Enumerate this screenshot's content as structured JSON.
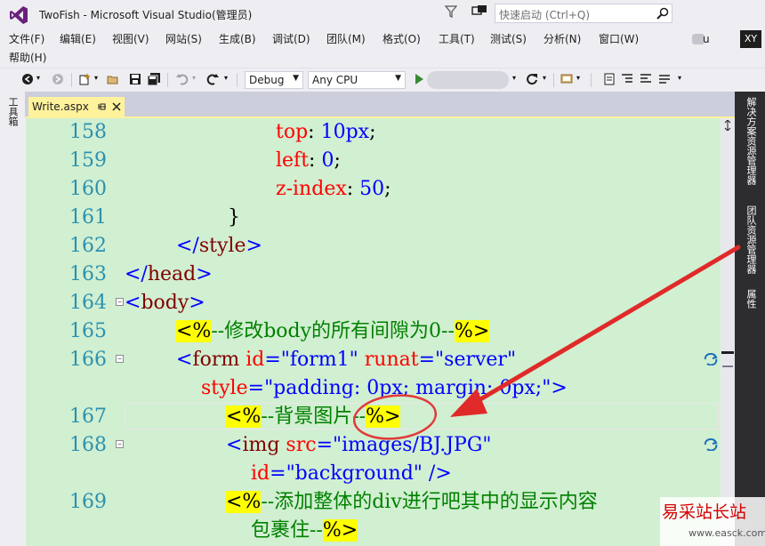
{
  "window": {
    "title": "TwoFish - Microsoft Visual Studio(管理员)",
    "quick_launch_placeholder": "快速启动 (Ctrl+Q)"
  },
  "menu": {
    "items": [
      "文件(F)",
      "编辑(E)",
      "视图(V)",
      "网站(S)",
      "生成(B)",
      "调试(D)",
      "团队(M)",
      "格式(O)",
      "工具(T)",
      "测试(S)",
      "分析(N)",
      "窗口(W)",
      "帮助(H)"
    ],
    "user_name": "u",
    "user_badge": "XY"
  },
  "toolbar": {
    "config": "Debug",
    "platform": "Any CPU"
  },
  "left_strip": {
    "toolbox": "工具箱"
  },
  "tab": {
    "label": "Write.aspx"
  },
  "right_strip": {
    "tabs": [
      "解决方案资源管理器",
      "团队资源管理器",
      "属性"
    ]
  },
  "code": {
    "lines": [
      {
        "num": "158",
        "parts": [
          [
            "k-prop",
            "top"
          ],
          [
            "k-txt",
            ": "
          ],
          [
            "k-val",
            "10px"
          ],
          [
            "k-txt",
            ";"
          ]
        ]
      },
      {
        "num": "159",
        "parts": [
          [
            "k-prop",
            "left"
          ],
          [
            "k-txt",
            ": "
          ],
          [
            "k-val",
            "0"
          ],
          [
            "k-txt",
            ";"
          ]
        ]
      },
      {
        "num": "160",
        "parts": [
          [
            "k-prop",
            "z-index"
          ],
          [
            "k-txt",
            ": "
          ],
          [
            "k-val",
            "50"
          ],
          [
            "k-txt",
            ";"
          ]
        ]
      },
      {
        "num": "161",
        "parts": [
          [
            "k-txt",
            "}"
          ]
        ]
      },
      {
        "num": "162",
        "parts": [
          [
            "k-br",
            "</"
          ],
          [
            "k-tag",
            "style"
          ],
          [
            "k-br",
            ">"
          ]
        ]
      },
      {
        "num": "163",
        "parts": [
          [
            "k-br",
            "</"
          ],
          [
            "k-tag",
            "head"
          ],
          [
            "k-br",
            ">"
          ]
        ]
      },
      {
        "num": "164",
        "parts": [
          [
            "k-br",
            "<"
          ],
          [
            "k-tag",
            "body"
          ],
          [
            "k-br",
            ">"
          ]
        ]
      },
      {
        "num": "165",
        "parts": [
          [
            "k-hl",
            "<%"
          ],
          [
            "k-com",
            "--修改body的所有间隙为0--"
          ],
          [
            "k-hl",
            "%>"
          ]
        ]
      },
      {
        "num": "166",
        "parts": [
          [
            "k-br",
            "<"
          ],
          [
            "k-tag",
            "form"
          ],
          [
            "k-txt",
            " "
          ],
          [
            "k-attr",
            "id"
          ],
          [
            "k-br",
            "="
          ],
          [
            "k-str",
            "\"form1\""
          ],
          [
            "k-txt",
            " "
          ],
          [
            "k-attr",
            "runat"
          ],
          [
            "k-br",
            "="
          ],
          [
            "k-str",
            "\"server\""
          ]
        ]
      },
      {
        "num": "",
        "parts": [
          [
            "k-attr",
            "style"
          ],
          [
            "k-br",
            "="
          ],
          [
            "k-str",
            "\"padding: 0px; margin: 0px;\""
          ],
          [
            "k-br",
            ">"
          ]
        ]
      },
      {
        "num": "167",
        "parts": [
          [
            "k-hl",
            "<%"
          ],
          [
            "k-com",
            "--背景图片--"
          ],
          [
            "k-hl",
            "%>"
          ]
        ]
      },
      {
        "num": "168",
        "parts": [
          [
            "k-br",
            "<"
          ],
          [
            "k-tag",
            "img"
          ],
          [
            "k-txt",
            " "
          ],
          [
            "k-attr",
            "src"
          ],
          [
            "k-br",
            "="
          ],
          [
            "k-str",
            "\"images/BJ.JPG\""
          ]
        ]
      },
      {
        "num": "",
        "parts": [
          [
            "k-attr",
            "id"
          ],
          [
            "k-br",
            "="
          ],
          [
            "k-str",
            "\"background\""
          ],
          [
            "k-txt",
            " "
          ],
          [
            "k-br",
            "/>"
          ]
        ]
      },
      {
        "num": "169",
        "parts": [
          [
            "k-hl",
            "<%"
          ],
          [
            "k-com",
            "--添加整体的div进行吧其中的显示内容"
          ]
        ]
      },
      {
        "num": "",
        "parts": [
          [
            "k-com",
            "包裹住--"
          ],
          [
            "k-hl",
            "%>"
          ]
        ]
      }
    ]
  },
  "watermark": {
    "main": "易采站长站",
    "sub": "www.easck.com"
  }
}
